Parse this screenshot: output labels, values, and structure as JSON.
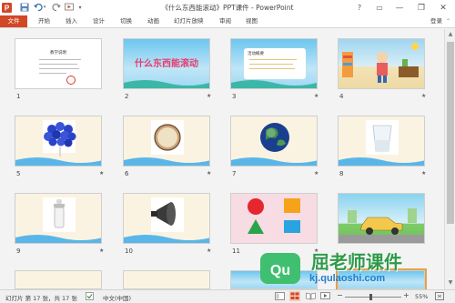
{
  "window": {
    "title": "《什么东西能滚动》PPT课件 - PowerPoint",
    "help": "?",
    "controls": [
      "▭",
      "—",
      "❐",
      "✕"
    ]
  },
  "quick_access": {
    "undo_arrow": "▾"
  },
  "ribbon": {
    "tabs": [
      "文件",
      "开始",
      "插入",
      "设计",
      "切换",
      "动画",
      "幻灯片放映",
      "审阅",
      "视图"
    ],
    "login": "登录",
    "collapse": "⌃"
  },
  "slides": [
    {
      "num": "1",
      "star": "",
      "title_text": "教学说明",
      "bg": "white"
    },
    {
      "num": "2",
      "star": "★",
      "title_text": "什么东西能滚动",
      "bg": "sky"
    },
    {
      "num": "3",
      "star": "★",
      "title_text": "活动概要",
      "bg": "sky"
    },
    {
      "num": "4",
      "star": "★",
      "title_text": "",
      "bg": "room"
    },
    {
      "num": "5",
      "star": "★",
      "title_text": "",
      "bg": "cream"
    },
    {
      "num": "6",
      "star": "★",
      "title_text": "",
      "bg": "cream"
    },
    {
      "num": "7",
      "star": "★",
      "title_text": "",
      "bg": "cream"
    },
    {
      "num": "8",
      "star": "★",
      "title_text": "",
      "bg": "cream"
    },
    {
      "num": "9",
      "star": "★",
      "title_text": "",
      "bg": "cream"
    },
    {
      "num": "10",
      "star": "★",
      "title_text": "",
      "bg": "cream"
    },
    {
      "num": "11",
      "star": "★",
      "title_text": "",
      "bg": "pink"
    },
    {
      "num": "12",
      "star": "",
      "title_text": "",
      "bg": "road"
    }
  ],
  "status": {
    "slide_info": "幻灯片 第 17 张，共 17 张",
    "language": "中文(中国)",
    "zoom": "55%",
    "zoom_minus": "−",
    "zoom_plus": "+"
  },
  "watermark": {
    "brand": "屈老师课件",
    "url": "kj.qulaoshi.com",
    "logo_text": "Qu"
  }
}
